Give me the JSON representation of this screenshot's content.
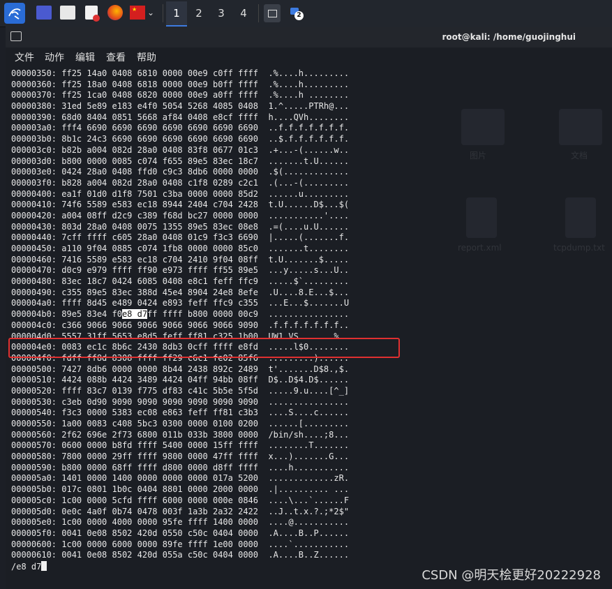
{
  "taskbar": {
    "workspaces": [
      "1",
      "2",
      "3",
      "4"
    ],
    "active_workspace": 0,
    "notification_count": "2",
    "icons": [
      "kali-menu-icon",
      "desktop-icon",
      "file-manager-icon",
      "text-editor-icon",
      "firefox-icon",
      "flag-icon",
      "chevron-down-icon",
      "terminal-icon",
      "network-icon"
    ]
  },
  "window": {
    "title": "root@kali: /home/guojinghui",
    "menu": [
      "文件",
      "动作",
      "编辑",
      "查看",
      "帮助"
    ]
  },
  "terminal": {
    "lines": [
      "00000350: ff25 14a0 0408 6810 0000 00e9 c0ff ffff  .%....h.........",
      "00000360: ff25 18a0 0408 6818 0000 00e9 b0ff ffff  .%....h.........",
      "00000370: ff25 1ca0 0408 6820 0000 00e9 a0ff ffff  .%....h ........",
      "00000380: 31ed 5e89 e183 e4f0 5054 5268 4085 0408  1.^.....PTRh@...",
      "00000390: 68d0 8404 0851 5668 af84 0408 e8cf ffff  h....QVh........",
      "000003a0: fff4 6690 6690 6690 6690 6690 6690 6690  ..f.f.f.f.f.f.f.",
      "000003b0: 8b1c 24c3 6690 6690 6690 6690 6690 6690  ..$.f.f.f.f.f.f.",
      "000003c0: b82b a004 082d 28a0 0408 83f8 0677 01c3  .+...-(......w..",
      "000003d0: b800 0000 0085 c074 f655 89e5 83ec 18c7  .......t.U......",
      "000003e0: 0424 28a0 0408 ffd0 c9c3 8db6 0000 0000  .$(.............",
      "000003f0: b828 a004 082d 28a0 0408 c1f8 0289 c2c1  .(...-(.........",
      "00000400: ea1f 01d0 d1f8 7501 c3ba 0000 0000 85d2  ......u.........",
      "00000410: 74f6 5589 e583 ec18 8944 2404 c704 2428  t.U......D$...$(",
      "00000420: a004 08ff d2c9 c389 f68d bc27 0000 0000  ...........'....",
      "00000430: 803d 28a0 0408 0075 1355 89e5 83ec 08e8  .=(....u.U......",
      "00000440: 7cff ffff c605 28a0 0408 01c9 f3c3 6690  |.....(.......f.",
      "00000450: a110 9f04 0885 c074 1fb8 0000 0000 85c0  .......t........",
      "00000460: 7416 5589 e583 ec18 c704 2410 9f04 08ff  t.U.......$.....",
      "00000470: d0c9 e979 ffff ff90 e973 ffff ff55 89e5  ...y.....s...U..",
      "00000480: 83ec 18c7 0424 6085 0408 e8c1 feff ffc9  .....$`.........",
      "00000490: c355 89e5 83ec 388d 45e4 8904 24e8 8efe  .U....8.E...$...",
      "000004a0: ffff 8d45 e489 0424 e893 feff ffc9 c355  ...E...$.......U",
      "000004b0: 89e5 83e4 f0e8 d7ff ffff b800 0000 00c9  ................",
      "000004c0: c366 9066 9066 9066 9066 9066 9066 9090  .f.f.f.f.f.f.f..",
      "000004d0: 5557 31ff 5653 e8d5 feff ff81 c325 1b00  UW1.VS.......%..",
      "000004e0: 0083 ec1c 8b6c 2430 8db3 0cff ffff e8fd  .....l$0........",
      "000004f0: fdff ff8d 8308 ffff ff29 c6c1 fe02 85f6  .........)......",
      "00000500: 7427 8db6 0000 0000 8b44 2438 892c 2489  t'.......D$8.,$.",
      "00000510: 4424 088b 4424 3489 4424 04ff 94bb 08ff  D$..D$4.D$......",
      "00000520: ffff 83c7 0139 f775 df83 c41c 5b5e 5f5d  .....9.u....[^_]",
      "00000530: c3eb 0d90 9090 9090 9090 9090 9090 9090  ................",
      "00000540: f3c3 0000 5383 ec08 e863 feff ff81 c3b3  ....S....c......",
      "00000550: 1a00 0083 c408 5bc3 0300 0000 0100 0200  ......[.........",
      "00000560: 2f62 696e 2f73 6800 011b 033b 3800 0000  /bin/sh....;8...",
      "00000570: 0600 0000 b8fd ffff 5400 0000 15ff ffff  ........T.......",
      "00000580: 7800 0000 29ff ffff 9800 0000 47ff ffff  x...).......G...",
      "00000590: b800 0000 68ff ffff d800 0000 d8ff ffff  ....h...........",
      "000005a0: 1401 0000 1400 0000 0000 0000 017a 5200  .............zR.",
      "000005b0: 017c 0801 1b0c 0404 8801 0000 2000 0000  .|.......... ...",
      "000005c0: 1c00 0000 5cfd ffff 6000 0000 000e 0846  ....\\...`......F",
      "000005d0: 0e0c 4a0f 0b74 0478 003f 1a3b 2a32 2422  ..J..t.x.?.;*2$\"",
      "000005e0: 1c00 0000 4000 0000 95fe ffff 1400 0000  ....@...........",
      "000005f0: 0041 0e08 8502 420d 0550 c50c 0404 0000  .A....B..P......",
      "00000600: 1c00 0000 6000 0000 89fe ffff 1e00 0000  ....`...........",
      "00000610: 0041 0e08 8502 420d 055a c50c 0404 0000  .A....B..Z......"
    ],
    "highlight": {
      "prefix": "000004b0: 89e5 83e4 f0",
      "selected": "e8 d7",
      "suffix": "ff ffff b800 0000 00c9  ................"
    },
    "prompt": "/e8 d7"
  },
  "background_ghosts": {
    "folder1": "图片",
    "folder2": "文档",
    "file1": "report.xml",
    "file2": "tcpdump.txt"
  },
  "watermark": "CSDN @明天桧更好20222928"
}
